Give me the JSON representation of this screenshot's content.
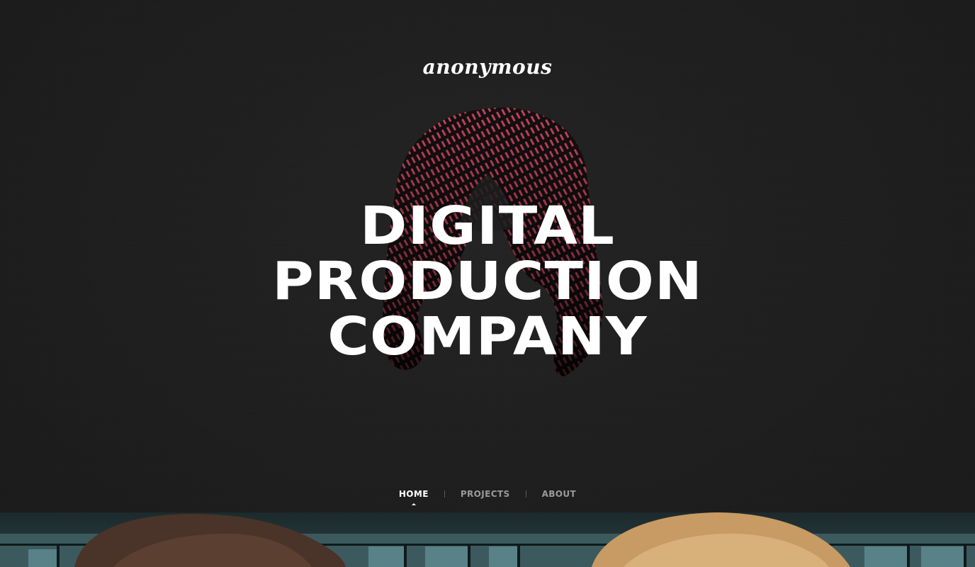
{
  "brand": {
    "logo_text": "anonymous"
  },
  "hero": {
    "headline_lines": [
      "DIGITAL",
      "PRODUCTION",
      "COMPANY"
    ],
    "emblem_icon": "glitch-a-letter-icon",
    "accent_color": "#d14a63"
  },
  "nav": {
    "items": [
      {
        "label": "HOME",
        "active": true
      },
      {
        "label": "PROJECTS",
        "active": false
      },
      {
        "label": "ABOUT",
        "active": false
      }
    ]
  },
  "colors": {
    "background": "#1e1e1e",
    "text_primary": "#ffffff",
    "text_muted": "#9a9a9a"
  }
}
